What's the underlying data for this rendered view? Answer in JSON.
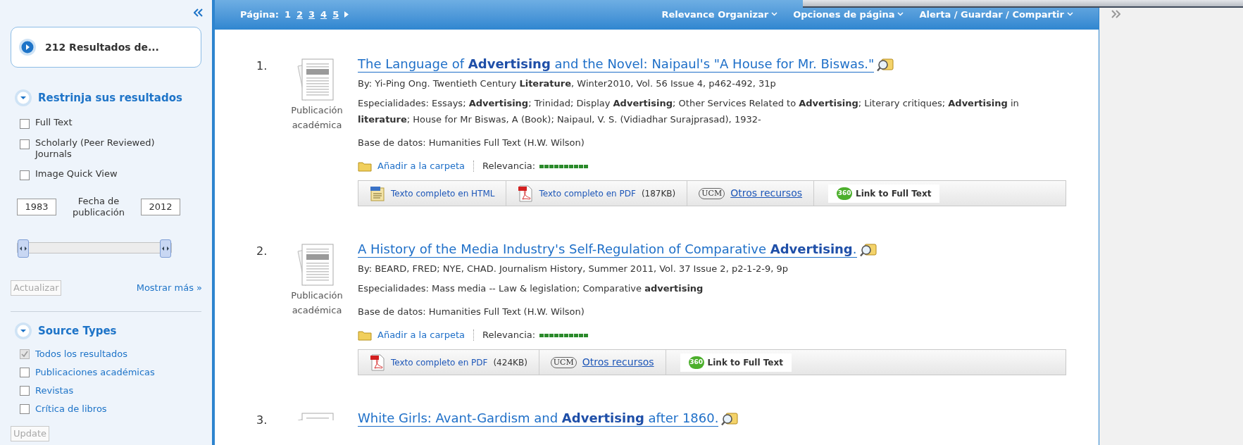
{
  "results_summary": "212 Resultados de...",
  "refine": {
    "heading": "Restrinja sus resultados",
    "expanded": true,
    "options": [
      {
        "label": "Full Text",
        "checked": false
      },
      {
        "label": "Scholarly (Peer Reviewed) Journals",
        "checked": false
      },
      {
        "label": "Image Quick View",
        "checked": false
      }
    ],
    "date": {
      "from": "1983",
      "label": "Fecha de publicación",
      "to": "2012"
    },
    "slider": {
      "thumbs": [
        {
          "level": 0
        },
        {
          "level": 1
        }
      ]
    },
    "update_button": {
      "label": "Actualizar",
      "disabled": true
    },
    "more_link": "Mostrar más »"
  },
  "source_types": {
    "heading": "Source Types",
    "expanded": true,
    "options": [
      {
        "label": "Todos los resultados",
        "checked": true,
        "disabled": true
      },
      {
        "label": "Publicaciones académicas",
        "checked": false,
        "disabled": false
      },
      {
        "label": "Revistas",
        "checked": false,
        "disabled": false
      },
      {
        "label": "Crítica de libros",
        "checked": false,
        "disabled": false
      }
    ],
    "update_button": {
      "label": "Update",
      "disabled": true
    }
  },
  "toolbar": {
    "page_label": "Página:",
    "pages": [
      {
        "label": "1",
        "selected": true
      },
      {
        "label": "2",
        "selected": false
      },
      {
        "label": "3",
        "selected": false
      },
      {
        "label": "4",
        "selected": false
      },
      {
        "label": "5",
        "selected": false
      }
    ],
    "menus": [
      "Relevance Organizar",
      "Opciones de página",
      "Alerta / Guardar / Compartir"
    ]
  },
  "results": [
    {
      "number": "1.",
      "type_label": "Publicación académica",
      "title": "The Language of **Advertising** and the Novel: Naipaul's \"A House for Mr. Biswas.\"",
      "byline": "By: Yi-Ping Ong. Twentieth Century **Literature**, Winter2010, Vol. 56 Issue 4, p462-492, 31p",
      "subjects": "Especialidades: Essays; **Advertising**; Trinidad; Display **Advertising**; Other Services Related to **Advertising**; Literary critiques; **Advertising** in **literature**; House for Mr Biswas, A (Book); Naipaul, V. S. (Vidiadhar Surajprasad), 1932-",
      "database": "Base de datos: Humanities Full Text (H.W. Wilson)",
      "folder_link": "Añadir a la carpeta",
      "relevance": {
        "label": "Relevancia:",
        "level": 1
      },
      "links": [
        {
          "kind": "html",
          "label": "Texto completo en HTML"
        },
        {
          "kind": "pdf",
          "label": "Texto completo en PDF",
          "size": "(187KB)"
        },
        {
          "kind": "ucm",
          "badge": "UCM",
          "label": "Otros recursos"
        },
        {
          "kind": "link360",
          "badge": "360",
          "label": "Link to Full Text"
        }
      ]
    },
    {
      "number": "2.",
      "type_label": "Publicación académica",
      "title": "A History of the Media Industry's Self-Regulation of Comparative **Advertising**.",
      "byline": "By: BEARD, FRED; NYE, CHAD. Journalism History, Summer 2011, Vol. 37 Issue 2, p2-1-2-9, 9p",
      "subjects": "Especialidades: Mass media -- Law & legislation; Comparative **advertising**",
      "database": "Base de datos: Humanities Full Text (H.W. Wilson)",
      "folder_link": "Añadir a la carpeta",
      "relevance": {
        "label": "Relevancia:",
        "level": 1
      },
      "links": [
        {
          "kind": "pdf",
          "label": "Texto completo en PDF",
          "size": "(424KB)"
        },
        {
          "kind": "ucm",
          "badge": "UCM",
          "label": "Otros recursos"
        },
        {
          "kind": "link360",
          "badge": "360",
          "label": "Link to Full Text"
        }
      ]
    },
    {
      "number": "3.",
      "title": "White Girls: Avant-Gardism and **Advertising** after 1860."
    }
  ]
}
